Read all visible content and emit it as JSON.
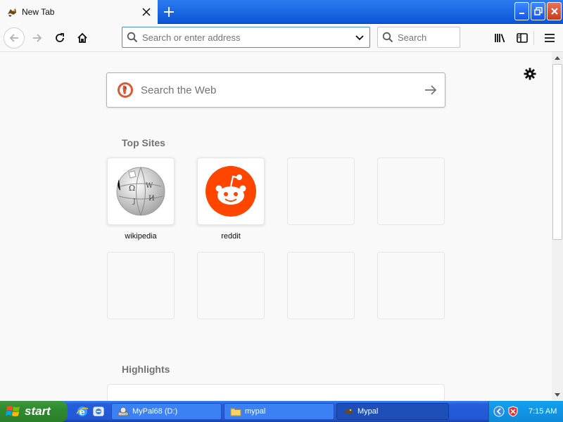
{
  "window": {
    "tab_title": "New Tab",
    "new_tab_symbol": "+"
  },
  "navbar": {
    "url_placeholder": "Search or enter address",
    "search_placeholder": "Search"
  },
  "newtab": {
    "web_search_placeholder": "Search the Web",
    "top_sites_title": "Top Sites",
    "highlights_title": "Highlights",
    "top_sites": [
      {
        "label": "wikipedia",
        "icon": "wikipedia-globe-icon"
      },
      {
        "label": "reddit",
        "icon": "reddit-alien-icon"
      }
    ]
  },
  "taskbar": {
    "start_label": "start",
    "tasks": [
      {
        "label": "MyPal68 (D:)",
        "icon": "drive-icon"
      },
      {
        "label": "mypal",
        "icon": "folder-icon"
      },
      {
        "label": "Mypal",
        "icon": "mypal-icon"
      }
    ],
    "clock": "7:15 AM"
  },
  "colors": {
    "accent": "#0a84ff",
    "reddit": "#ff4500",
    "duckduckgo": "#de5833",
    "xp_blue": "#245edb",
    "xp_green": "#3c9a3c"
  }
}
